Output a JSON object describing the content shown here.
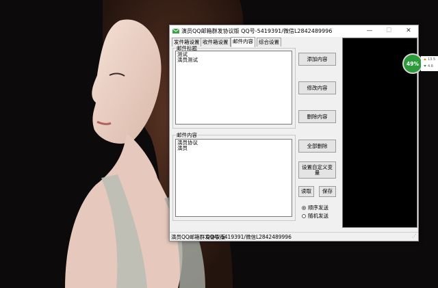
{
  "window": {
    "title": "演员QQ邮箱群发协议版  QQ号-5419391/微信L2842489996",
    "controls": {
      "minimize": "—",
      "maximize": "☐",
      "close": "✕"
    }
  },
  "tabs": [
    "发件箱设置",
    "收件箱设置",
    "邮件内容",
    "综合设置"
  ],
  "active_tab": 2,
  "subject_section": {
    "label": "邮件标题",
    "lines": [
      "测试",
      "演员测试"
    ]
  },
  "content_section": {
    "label": "邮件内容",
    "lines": [
      "演员协议",
      "演员"
    ]
  },
  "buttons": {
    "add": "添加内容",
    "edit": "修改内容",
    "delete": "删除内容",
    "delete_all": "全部删除",
    "custom_var_line1": "设置自定义变",
    "custom_var_line2": "量",
    "read": "读取",
    "save": "保存"
  },
  "send_mode": {
    "options": [
      "顺序发送",
      "随机发送"
    ],
    "selected": 0
  },
  "status_bar": {
    "left": "演员QQ邮箱群发协议版",
    "right": "QQ号-5419391/微信L2842489996"
  },
  "net_meter": {
    "percent": "49%",
    "upload": "13.5",
    "download": "4.6"
  },
  "colors": {
    "meter_green": "#2c9a3a",
    "log_background": "#000000",
    "window_background": "#f0f0f0"
  }
}
